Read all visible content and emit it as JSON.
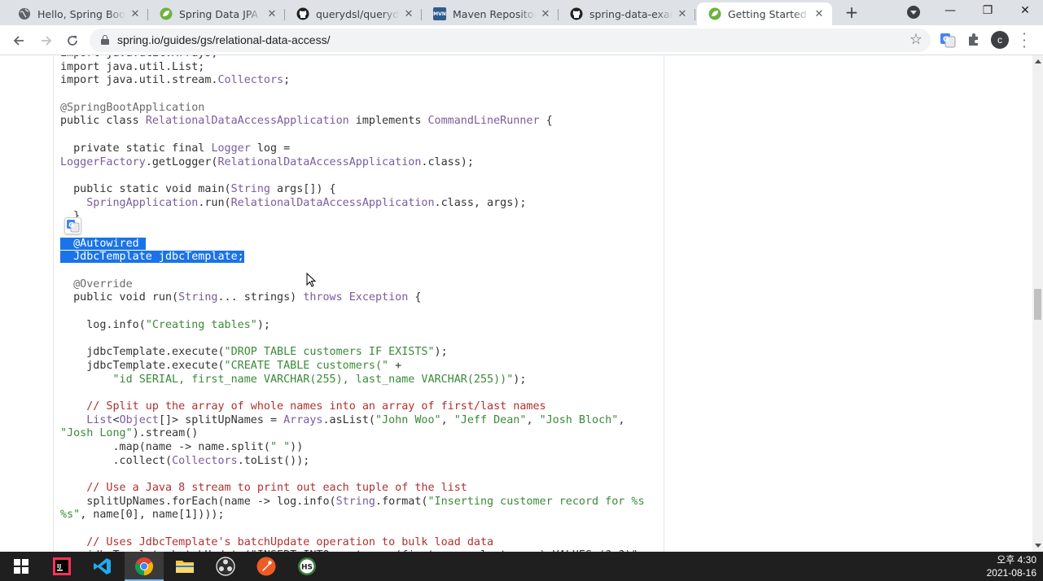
{
  "browser": {
    "tabs": [
      {
        "title": "Hello, Spring Boot!",
        "icon": "globe-icon",
        "active": false
      },
      {
        "title": "Spring Data JPA - R",
        "icon": "spring-leaf-icon",
        "active": false
      },
      {
        "title": "querydsl/querydsl-j",
        "icon": "github-icon",
        "active": false
      },
      {
        "title": "Maven Repository:",
        "icon": "mvn-icon",
        "active": false
      },
      {
        "title": "spring-data-examp",
        "icon": "github-icon",
        "active": false
      },
      {
        "title": "Getting Started | A",
        "icon": "spring-leaf-icon",
        "active": true
      }
    ],
    "new_tab": "+",
    "window_controls": {
      "minimize": "—",
      "maximize": "❐",
      "close": "✕"
    },
    "url": "spring.io/guides/gs/relational-data-access/",
    "avatar_letter": "c"
  },
  "code_lines": [
    [
      {
        "t": "import java.util.Arrays;",
        "c": "kw"
      }
    ],
    [
      {
        "t": "import java.util.List;",
        "c": "kw"
      }
    ],
    [
      {
        "t": "import java.util.stream.",
        "c": "kw"
      },
      {
        "t": "Collectors",
        "c": "ty"
      },
      {
        "t": ";",
        "c": "kw"
      }
    ],
    [
      {
        "t": "",
        "c": "kw"
      }
    ],
    [
      {
        "t": "@SpringBootApplication",
        "c": "an"
      }
    ],
    [
      {
        "t": "public class ",
        "c": "kw"
      },
      {
        "t": "RelationalDataAccessApplication",
        "c": "ty"
      },
      {
        "t": " implements ",
        "c": "kw"
      },
      {
        "t": "CommandLineRunner",
        "c": "ty"
      },
      {
        "t": " {",
        "c": "kw"
      }
    ],
    [
      {
        "t": "",
        "c": "kw"
      }
    ],
    [
      {
        "t": "  private static final ",
        "c": "kw"
      },
      {
        "t": "Logger",
        "c": "ty"
      },
      {
        "t": " log =",
        "c": "kw"
      }
    ],
    [
      {
        "t": "LoggerFactory",
        "c": "ty"
      },
      {
        "t": ".getLogger(",
        "c": "kw"
      },
      {
        "t": "RelationalDataAccessApplication",
        "c": "ty"
      },
      {
        "t": ".class);",
        "c": "kw"
      }
    ],
    [
      {
        "t": "",
        "c": "kw"
      }
    ],
    [
      {
        "t": "  public static void main(",
        "c": "kw"
      },
      {
        "t": "String",
        "c": "ty"
      },
      {
        "t": " args[]) {",
        "c": "kw"
      }
    ],
    [
      {
        "t": "    ",
        "c": "kw"
      },
      {
        "t": "SpringApplication",
        "c": "ty"
      },
      {
        "t": ".run(",
        "c": "kw"
      },
      {
        "t": "RelationalDataAccessApplication",
        "c": "ty"
      },
      {
        "t": ".class, args);",
        "c": "kw"
      }
    ],
    [
      {
        "t": "  }",
        "c": "kw"
      }
    ],
    [
      {
        "t": "",
        "c": "kw"
      }
    ],
    [
      {
        "t": "  ",
        "c": "sel"
      },
      {
        "t": "@Autowired",
        "c": "sel"
      },
      {
        "t": " ",
        "c": "sel"
      }
    ],
    [
      {
        "t": "  JdbcTemplate jdbcTemplate;",
        "c": "sel"
      }
    ],
    [
      {
        "t": "",
        "c": "kw"
      }
    ],
    [
      {
        "t": "  @Override",
        "c": "an"
      }
    ],
    [
      {
        "t": "  public void run(",
        "c": "kw"
      },
      {
        "t": "String",
        "c": "ty"
      },
      {
        "t": "... strings) ",
        "c": "kw"
      },
      {
        "t": "throws",
        "c": "ty"
      },
      {
        "t": " ",
        "c": "kw"
      },
      {
        "t": "Exception",
        "c": "ty"
      },
      {
        "t": " {",
        "c": "kw"
      }
    ],
    [
      {
        "t": "",
        "c": "kw"
      }
    ],
    [
      {
        "t": "    log.info(",
        "c": "kw"
      },
      {
        "t": "\"Creating tables\"",
        "c": "str"
      },
      {
        "t": ");",
        "c": "kw"
      }
    ],
    [
      {
        "t": "",
        "c": "kw"
      }
    ],
    [
      {
        "t": "    jdbcTemplate.execute(",
        "c": "kw"
      },
      {
        "t": "\"DROP TABLE customers IF EXISTS\"",
        "c": "str"
      },
      {
        "t": ");",
        "c": "kw"
      }
    ],
    [
      {
        "t": "    jdbcTemplate.execute(",
        "c": "kw"
      },
      {
        "t": "\"CREATE TABLE customers(\"",
        "c": "str"
      },
      {
        "t": " +",
        "c": "kw"
      }
    ],
    [
      {
        "t": "        ",
        "c": "kw"
      },
      {
        "t": "\"id SERIAL, first_name VARCHAR(255), last_name VARCHAR(255))\"",
        "c": "str"
      },
      {
        "t": ");",
        "c": "kw"
      }
    ],
    [
      {
        "t": "",
        "c": "kw"
      }
    ],
    [
      {
        "t": "    // Split up the array of whole names into an array of first/last names",
        "c": "cm"
      }
    ],
    [
      {
        "t": "    ",
        "c": "kw"
      },
      {
        "t": "List",
        "c": "ty"
      },
      {
        "t": "<",
        "c": "kw"
      },
      {
        "t": "Object",
        "c": "ty"
      },
      {
        "t": "[]> splitUpNames = ",
        "c": "kw"
      },
      {
        "t": "Arrays",
        "c": "ty"
      },
      {
        "t": ".asList(",
        "c": "kw"
      },
      {
        "t": "\"John Woo\"",
        "c": "str"
      },
      {
        "t": ", ",
        "c": "kw"
      },
      {
        "t": "\"Jeff Dean\"",
        "c": "str"
      },
      {
        "t": ", ",
        "c": "kw"
      },
      {
        "t": "\"Josh Bloch\"",
        "c": "str"
      },
      {
        "t": ",",
        "c": "kw"
      }
    ],
    [
      {
        "t": "\"Josh Long\"",
        "c": "str"
      },
      {
        "t": ").stream()",
        "c": "kw"
      }
    ],
    [
      {
        "t": "        .map(name -> name.split(",
        "c": "kw"
      },
      {
        "t": "\" \"",
        "c": "str"
      },
      {
        "t": "))",
        "c": "kw"
      }
    ],
    [
      {
        "t": "        .collect(",
        "c": "kw"
      },
      {
        "t": "Collectors",
        "c": "ty"
      },
      {
        "t": ".toList());",
        "c": "kw"
      }
    ],
    [
      {
        "t": "",
        "c": "kw"
      }
    ],
    [
      {
        "t": "    // Use a Java 8 stream to print out each tuple of the list",
        "c": "cm"
      }
    ],
    [
      {
        "t": "    splitUpNames.forEach(name -> log.info(",
        "c": "kw"
      },
      {
        "t": "String",
        "c": "ty"
      },
      {
        "t": ".format(",
        "c": "kw"
      },
      {
        "t": "\"Inserting customer record for %s",
        "c": "str"
      }
    ],
    [
      {
        "t": "%s\"",
        "c": "str"
      },
      {
        "t": ", name[0], name[1])));",
        "c": "kw"
      }
    ],
    [
      {
        "t": "",
        "c": "kw"
      }
    ],
    [
      {
        "t": "    // Uses JdbcTemplate's batchUpdate operation to bulk load data",
        "c": "cm"
      }
    ],
    [
      {
        "t": "    jdbcTemplate.batchUpdate(\"INSERT INTO customers(first_name, last_name) VALUES (?,?)\", splitUpNames);",
        "c": "kw"
      }
    ]
  ],
  "taskbar": {
    "apps": [
      {
        "name": "start-button",
        "icon": "windows-logo-icon",
        "active": false
      },
      {
        "name": "intellij",
        "icon": "intellij-icon",
        "active": false
      },
      {
        "name": "vscode",
        "icon": "vscode-icon",
        "active": false
      },
      {
        "name": "chrome",
        "icon": "chrome-icon",
        "active": true
      },
      {
        "name": "file-explorer",
        "icon": "folder-icon",
        "active": false
      },
      {
        "name": "obs",
        "icon": "obs-icon",
        "active": false
      },
      {
        "name": "postman",
        "icon": "postman-icon",
        "active": false
      },
      {
        "name": "heidisql",
        "icon": "hs-icon",
        "active": false
      }
    ],
    "time": "오후 4:30",
    "date": "2021-08-16",
    "hs_label": "HS"
  },
  "colors": {
    "selection": "#1a73e8",
    "string": "#3a8a3a",
    "comment": "#b03030",
    "type": "#7a5c9e",
    "accent_blue": "#0078d7"
  }
}
